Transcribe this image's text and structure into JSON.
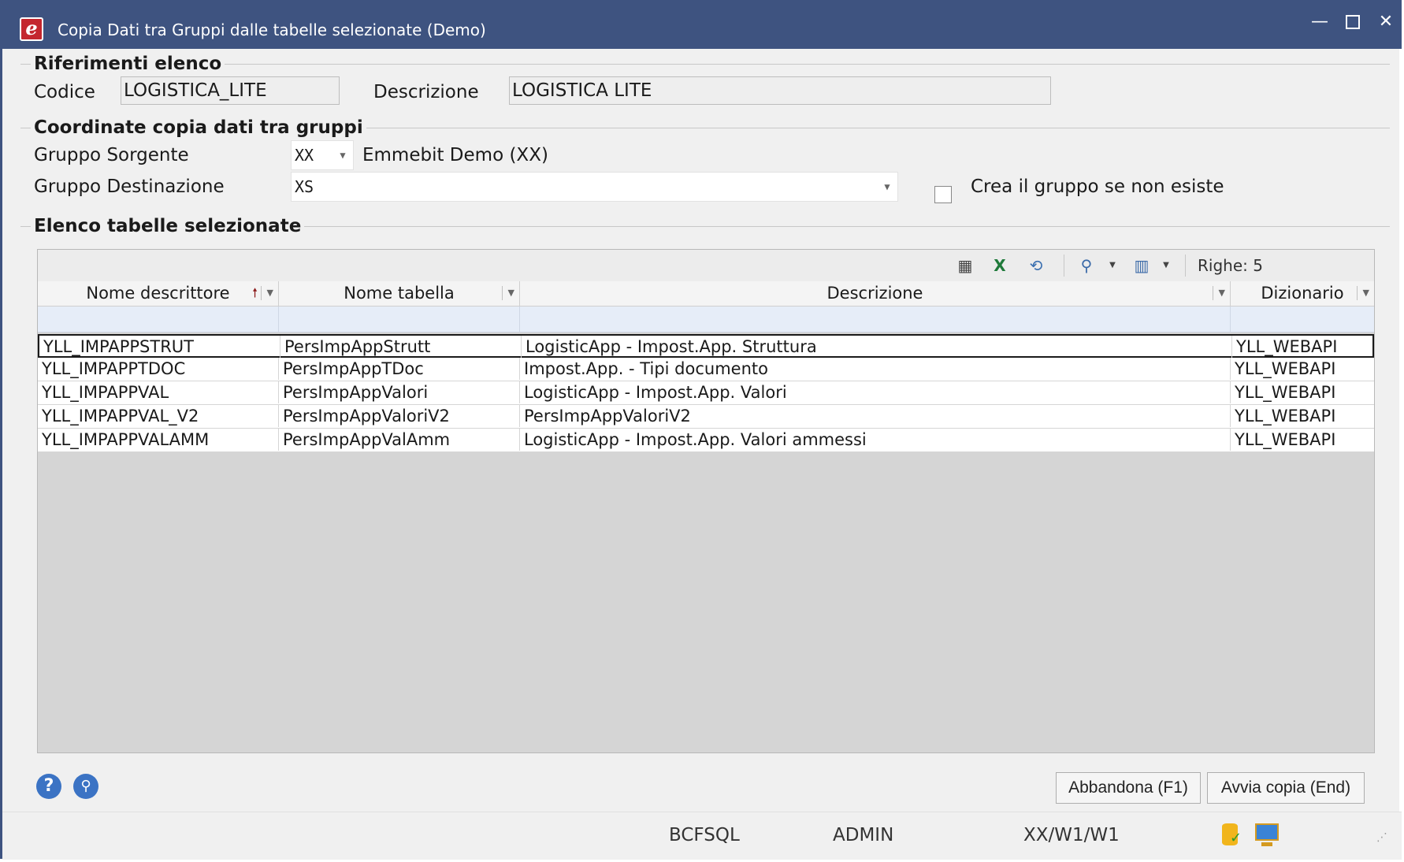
{
  "window": {
    "title": "Copia Dati tra Gruppi dalle tabelle selezionate  (Demo)",
    "app_icon_letter": "e",
    "minimize": "—",
    "close": "✕"
  },
  "section_riferimenti": {
    "title": "Riferimenti elenco",
    "codice_label": "Codice",
    "codice_value": "LOGISTICA_LITE",
    "descrizione_label": "Descrizione",
    "descrizione_value": "LOGISTICA LITE"
  },
  "section_coordinate": {
    "title": "Coordinate copia dati tra gruppi",
    "sorgente_label": "Gruppo Sorgente",
    "sorgente_value": "XX",
    "sorgente_desc": "Emmebit Demo (XX)",
    "destinazione_label": "Gruppo Destinazione",
    "destinazione_value": "XS",
    "crea_gruppo_label": "Crea il gruppo se non esiste",
    "crea_gruppo_checked": false
  },
  "section_elenco": {
    "title": "Elenco tabelle selezionate"
  },
  "grid": {
    "rows_count_label": "Righe: 5",
    "toolbar_icons": [
      "print-grid-icon",
      "excel-export-icon",
      "refresh-layout-icon",
      "search-icon",
      "column-chooser-icon"
    ],
    "columns": [
      "Nome descrittore",
      "Nome tabella",
      "Descrizione",
      "Dizionario"
    ],
    "sort_indicator": "🠕",
    "rows": [
      [
        "YLL_IMPAPPSTRUT",
        "PersImpAppStrutt",
        "LogisticApp - Impost.App. Struttura",
        "YLL_WEBAPI"
      ],
      [
        "YLL_IMPAPPTDOC",
        "PersImpAppTDoc",
        "Impost.App. - Tipi documento",
        "YLL_WEBAPI"
      ],
      [
        "YLL_IMPAPPVAL",
        "PersImpAppValori",
        "LogisticApp - Impost.App. Valori",
        "YLL_WEBAPI"
      ],
      [
        "YLL_IMPAPPVAL_V2",
        "PersImpAppValoriV2",
        "PersImpAppValoriV2",
        "YLL_WEBAPI"
      ],
      [
        "YLL_IMPAPPVALAMM",
        "PersImpAppValAmm",
        "LogisticApp - Impost.App. Valori ammessi",
        "YLL_WEBAPI"
      ]
    ]
  },
  "footer": {
    "help_label": "?",
    "abbandona_label": "Abbandona (F1)",
    "avvia_label": "Avvia copia (End)"
  },
  "status_bar": {
    "server": "BCFSQL",
    "user": "ADMIN",
    "context": "XX/W1/W1"
  },
  "colors": {
    "titlebar": "#3e5380",
    "grid_empty": "#d5d5d5",
    "filter_row": "#e6edf8"
  }
}
